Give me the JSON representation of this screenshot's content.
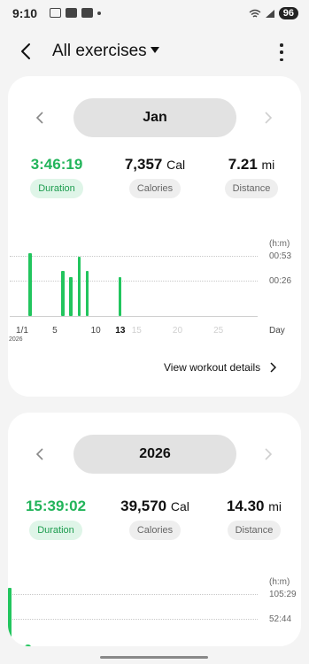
{
  "status_bar": {
    "time": "9:10",
    "battery": "96"
  },
  "header": {
    "title": "All exercises"
  },
  "monthly": {
    "period": "Jan",
    "duration": {
      "value": "3:46:19",
      "label": "Duration"
    },
    "calories": {
      "value": "7,357",
      "unit": "Cal",
      "label": "Calories"
    },
    "distance": {
      "value": "7.21",
      "unit": "mi",
      "label": "Distance"
    },
    "view_details": "View workout details",
    "chart_data": {
      "type": "bar",
      "y_unit": "(h:m)",
      "y_ticks": [
        "00:53",
        "00:26"
      ],
      "x_unit": "Day",
      "x_ticks": [
        "1/1",
        "5",
        "10",
        "13",
        "15",
        "20",
        "25"
      ],
      "x_sub_label": "2026",
      "selected_day": 13,
      "x": [
        2,
        6,
        7,
        8,
        9,
        13
      ],
      "values_minutes": [
        55,
        40,
        34,
        52,
        40,
        34
      ]
    }
  },
  "yearly": {
    "period": "2026",
    "duration": {
      "value": "15:39:02",
      "label": "Duration"
    },
    "calories": {
      "value": "39,570",
      "unit": "Cal",
      "label": "Calories"
    },
    "distance": {
      "value": "14.30",
      "unit": "mi",
      "label": "Distance"
    },
    "chart_data": {
      "type": "bar",
      "y_unit": "(h:m)",
      "y_ticks": [
        "105:29",
        "52:44"
      ]
    }
  },
  "colors": {
    "accent_green": "#22c55e"
  }
}
